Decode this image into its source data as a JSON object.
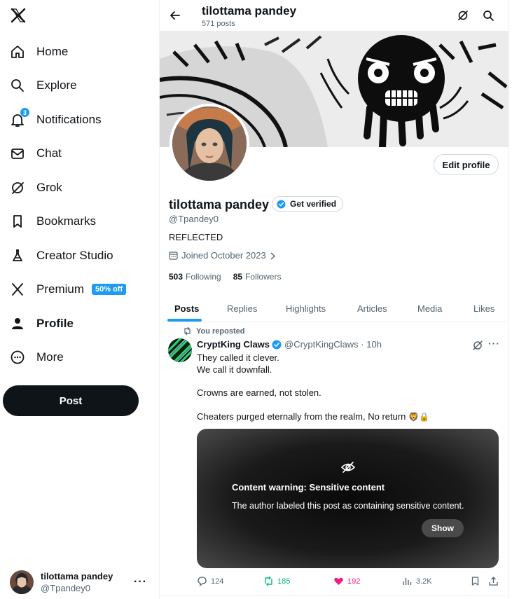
{
  "sidebar": {
    "logo": "x-logo-icon",
    "items": [
      {
        "label": "Home",
        "icon": "home-icon"
      },
      {
        "label": "Explore",
        "icon": "search-icon"
      },
      {
        "label": "Notifications",
        "icon": "bell-icon",
        "badge": "3"
      },
      {
        "label": "Chat",
        "icon": "mail-icon"
      },
      {
        "label": "Grok",
        "icon": "grok-icon"
      },
      {
        "label": "Bookmarks",
        "icon": "bookmark-icon"
      },
      {
        "label": "Creator Studio",
        "icon": "flask-icon"
      },
      {
        "label": "Premium",
        "icon": "x-premium-icon",
        "badge": "50% off"
      },
      {
        "label": "Profile",
        "icon": "person-icon"
      },
      {
        "label": "More",
        "icon": "more-circle-icon"
      }
    ],
    "post_button": "Post",
    "account": {
      "name": "tilottama pandey",
      "handle": "@Tpandey0",
      "more": "···"
    }
  },
  "header": {
    "title": "tilottama pandey",
    "subtitle": "571 posts"
  },
  "profile": {
    "edit_button": "Edit profile",
    "name": "tilottama pandey",
    "verify_label": "Get verified",
    "handle": "@Tpandey0",
    "bio": "REFLECTED",
    "joined": "Joined October 2023",
    "following_count": "503",
    "following_label": "Following",
    "followers_count": "85",
    "followers_label": "Followers"
  },
  "tabs": [
    {
      "label": "Posts",
      "active": true
    },
    {
      "label": "Replies"
    },
    {
      "label": "Highlights"
    },
    {
      "label": "Articles"
    },
    {
      "label": "Media"
    },
    {
      "label": "Likes"
    }
  ],
  "post": {
    "repost_label": "You reposted",
    "author": "CryptKing Claws",
    "handle": "@CryptKingClaws",
    "time": "10h",
    "more": "···",
    "lines": [
      "They called it clever.",
      "We call it downfall.",
      "Crowns are earned, not stolen.",
      "Cheaters purged eternally from the realm, No return"
    ],
    "emoji": "🦁🔒",
    "sensitive": {
      "title": "Content warning: Sensitive content",
      "description": "The author labeled this post as containing sensitive content.",
      "show_button": "Show"
    },
    "stats": {
      "replies": "124",
      "reposts": "185",
      "likes": "192",
      "views": "3.2K"
    }
  },
  "colors": {
    "accent": "#1d9bf0",
    "repost": "#00ba7c",
    "like": "#f91880",
    "text": "#0f1419",
    "muted": "#536471"
  }
}
